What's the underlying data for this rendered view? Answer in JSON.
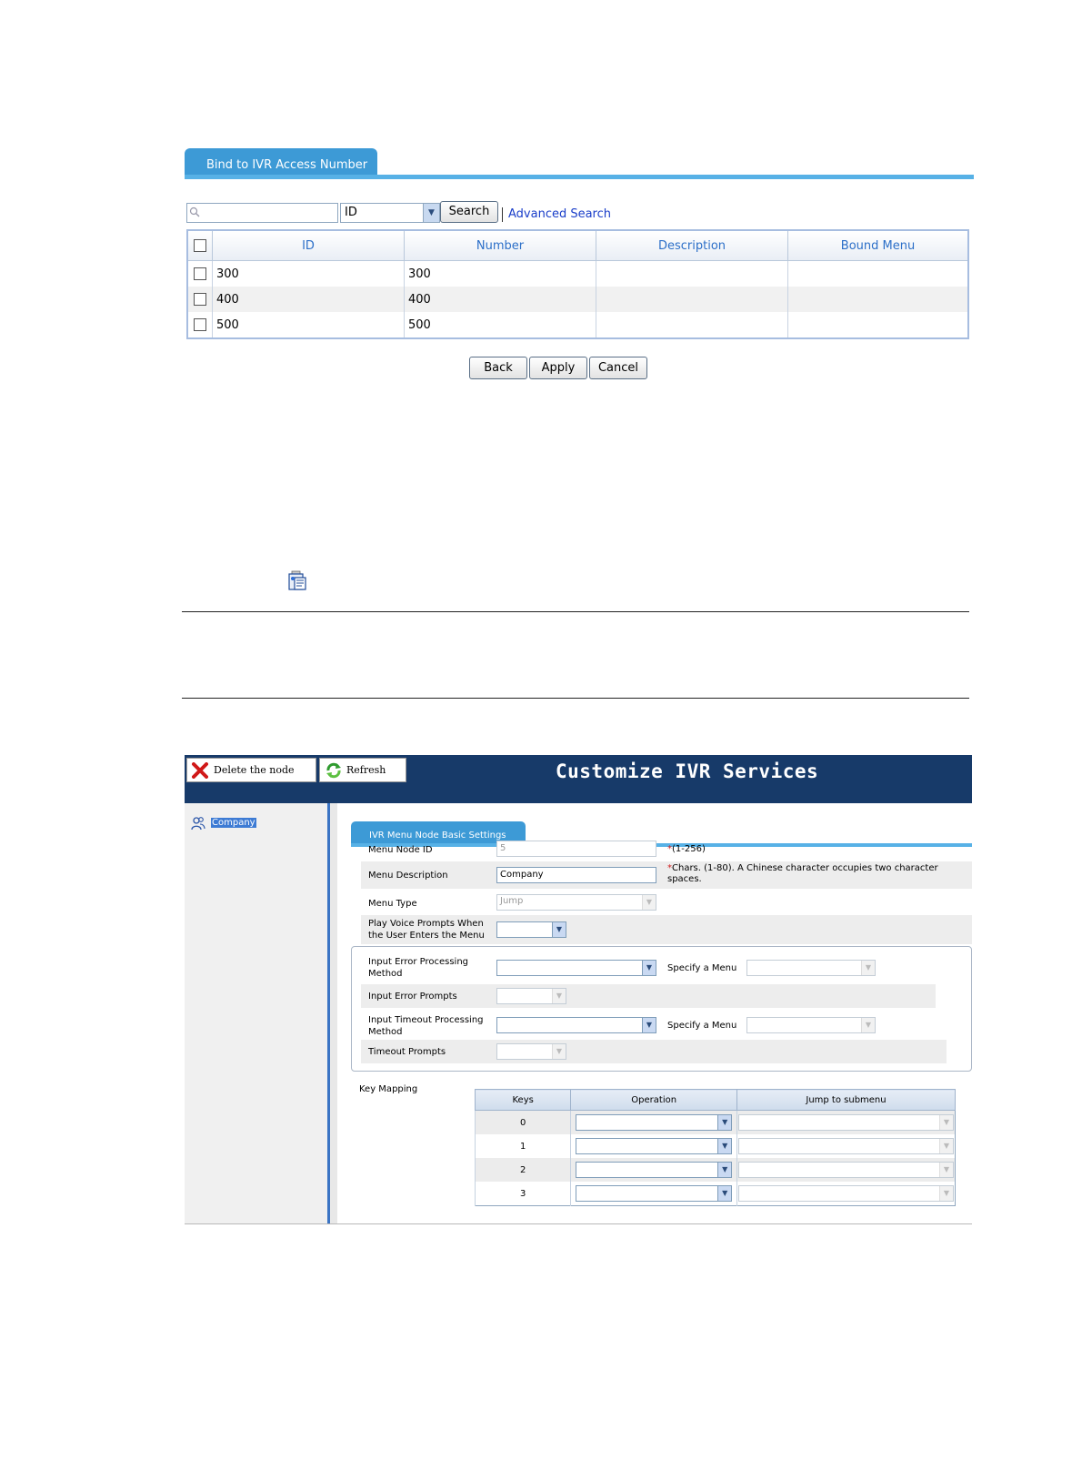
{
  "bind_screen": {
    "tab_label": "Bind to IVR Access Number",
    "search": {
      "value": "",
      "field_select": "ID",
      "search_button": "Search",
      "advanced_link": "Advanced Search"
    },
    "table": {
      "headers": [
        "ID",
        "Number",
        "Description",
        "Bound Menu"
      ],
      "rows": [
        {
          "id": "300",
          "number": "300",
          "description": "",
          "bound_menu": ""
        },
        {
          "id": "400",
          "number": "400",
          "description": "",
          "bound_menu": ""
        },
        {
          "id": "500",
          "number": "500",
          "description": "",
          "bound_menu": ""
        }
      ]
    },
    "buttons": {
      "back": "Back",
      "apply": "Apply",
      "cancel": "Cancel"
    }
  },
  "ivr_screen": {
    "toolbar": {
      "delete_label": "Delete the node",
      "refresh_label": "Refresh"
    },
    "title": "Customize IVR Services",
    "tree": {
      "root_label": "Company"
    },
    "tab_label": "IVR Menu Node Basic Settings",
    "fields": {
      "menu_node_id": {
        "label": "Menu Node ID",
        "value": "5",
        "hint_req": "*",
        "hint": "(1-256)"
      },
      "menu_description": {
        "label": "Menu Description",
        "value": "Company",
        "hint_req": "*",
        "hint": "Chars. (1-80). A Chinese character occupies two character spaces."
      },
      "menu_type": {
        "label": "Menu Type",
        "value": "Jump"
      },
      "play_voice": {
        "label": "Play Voice Prompts When the User Enters the Menu",
        "value": ""
      },
      "input_error_method": {
        "label": "Input Error Processing Method",
        "value": "",
        "specify_label": "Specify a Menu"
      },
      "input_error_prompts": {
        "label": "Input Error Prompts",
        "value": ""
      },
      "input_timeout_method": {
        "label": "Input Timeout Processing Method",
        "value": "",
        "specify_label": "Specify a Menu"
      },
      "timeout_prompts": {
        "label": "Timeout Prompts",
        "value": ""
      }
    },
    "key_mapping": {
      "label": "Key Mapping",
      "headers": [
        "Keys",
        "Operation",
        "Jump to submenu"
      ],
      "rows": [
        {
          "key": "0"
        },
        {
          "key": "1"
        },
        {
          "key": "2"
        },
        {
          "key": "3"
        }
      ]
    }
  },
  "colors": {
    "header_navy": "#173a69",
    "tab_blue": "#3d9ad6",
    "link_blue": "#1a3ec9",
    "table_header_text": "#2c6fc8"
  }
}
